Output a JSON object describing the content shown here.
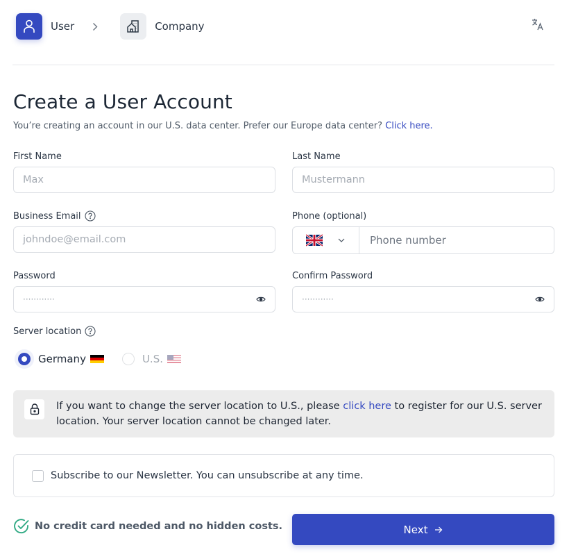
{
  "stepper": {
    "steps": [
      {
        "label": "User",
        "icon": "user-icon",
        "state": "active"
      },
      {
        "label": "Company",
        "icon": "building-icon",
        "state": "inactive"
      }
    ],
    "language_icon": "translate-icon"
  },
  "header": {
    "title": "Create a User Account",
    "subtitle": "You’re creating an account in our U.S. data center. Prefer our Europe data center?",
    "subtitle_link": "Click here."
  },
  "form": {
    "first_name": {
      "label": "First Name",
      "placeholder": "Max",
      "value": ""
    },
    "last_name": {
      "label": "Last Name",
      "placeholder": "Mustermann",
      "value": ""
    },
    "email": {
      "label": "Business Email",
      "placeholder": "johndoe@email.com",
      "value": "",
      "help_icon": "question-circle-icon"
    },
    "phone": {
      "label": "Phone (optional)",
      "country": "United Kingdom",
      "country_flag": "flag-gb",
      "placeholder": "Phone number",
      "value": ""
    },
    "password": {
      "label": "Password",
      "masked_value": "············",
      "toggle_icon": "eye-icon"
    },
    "confirm_password": {
      "label": "Confirm Password",
      "masked_value": "············",
      "toggle_icon": "eye-icon"
    },
    "server_location": {
      "label": "Server location",
      "options": [
        {
          "label": "Germany",
          "flag": "flag-de",
          "selected": true,
          "disabled": false
        },
        {
          "label": "U.S.",
          "flag": "flag-us",
          "selected": false,
          "disabled": true
        }
      ]
    }
  },
  "info": {
    "text_before": "If you want to change the server location to U.S., please ",
    "link": "click here",
    "text_after": " to register for our U.S. server location. Your server location cannot be changed later."
  },
  "newsletter": {
    "label": "Subscribe to our Newsletter. You can unsubscribe at any time.",
    "checked": false
  },
  "footer": {
    "no_credit_card": "No credit card needed and no hidden costs.",
    "next_label": "Next"
  },
  "colors": {
    "primary": "#3449c0",
    "success": "#2fa983",
    "info_bg": "#ececec"
  }
}
